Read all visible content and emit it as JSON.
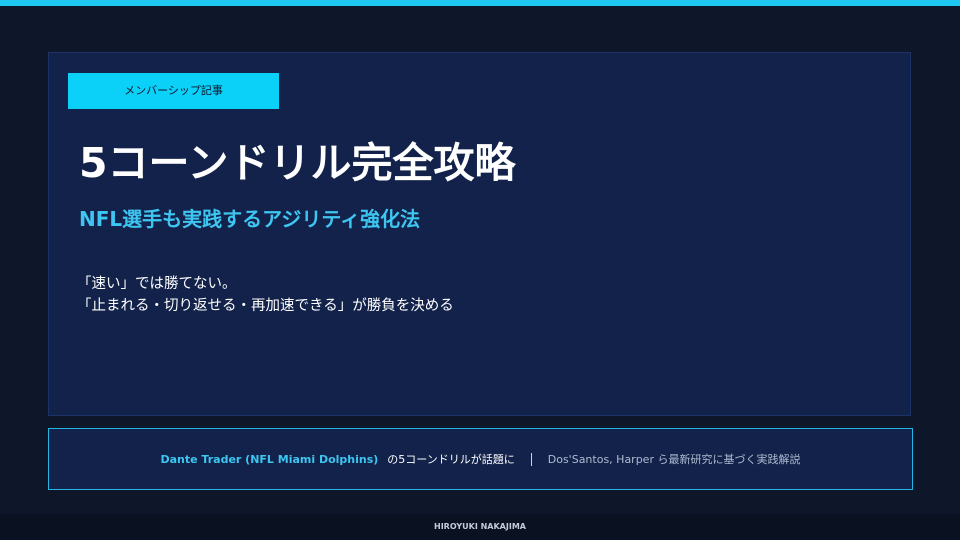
{
  "badge": "メンバーシップ記事",
  "title": "5コーンドリル完全攻略",
  "subtitle": "NFL選手も実践するアジリティ強化法",
  "lede": {
    "line1": "「速い」では勝てない。",
    "line2": "「止まれる・切り返せる・再加速できる」が勝負を決める"
  },
  "banner": {
    "highlight": "Dante Trader (NFL Miami Dolphins)",
    "text": "の5コーンドリルが話題に",
    "secondary": "Dos'Santos, Harper ら最新研究に基づく実践解説"
  },
  "author": "HIROYUKI NAKAJIMA",
  "colors": {
    "accent": "#1ec8f0",
    "background": "#0d1729",
    "panel": "#12224a",
    "subtitle": "#3ec6f2"
  }
}
